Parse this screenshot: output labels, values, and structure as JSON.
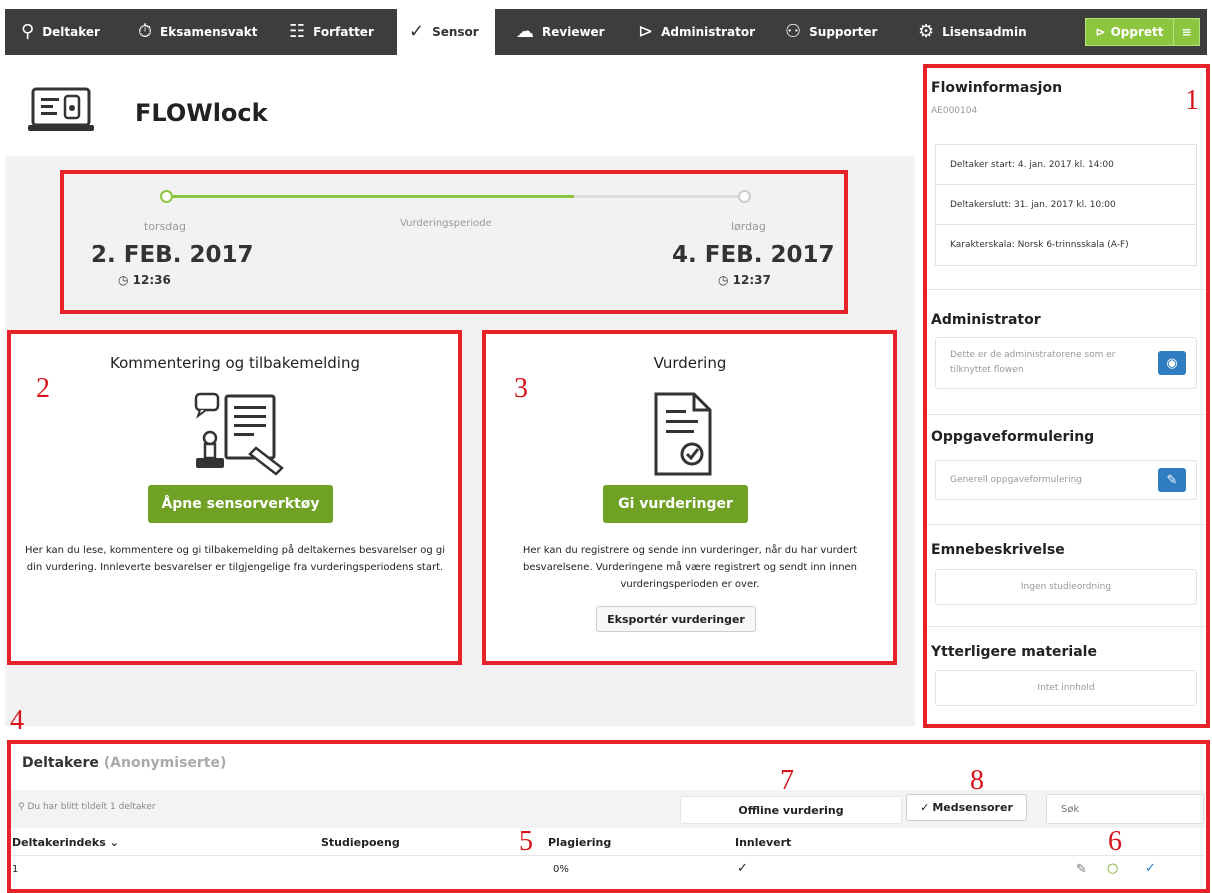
{
  "nav": {
    "tabs": [
      {
        "label": "Deltaker",
        "icon": "person-icon"
      },
      {
        "label": "Eksamensvakt",
        "icon": "stopwatch-icon"
      },
      {
        "label": "Forfatter",
        "icon": "list-icon"
      },
      {
        "label": "Sensor",
        "icon": "speech-check-icon"
      },
      {
        "label": "Reviewer",
        "icon": "speech-bubbles-icon"
      },
      {
        "label": "Administrator",
        "icon": "flow-icon"
      },
      {
        "label": "Supporter",
        "icon": "people-icon"
      },
      {
        "label": "Lisensadmin",
        "icon": "gear-person-icon"
      }
    ],
    "active_tab": "Sensor",
    "create_label": "Opprett"
  },
  "header": {
    "title": "FLOWlock"
  },
  "period": {
    "start_day": "torsdag",
    "start_date": "2. FEB. 2017",
    "start_time": "12:36",
    "label": "Vurderingsperiode",
    "end_day": "lørdag",
    "end_date": "4. FEB. 2017",
    "end_time": "12:37",
    "progress": 0.7
  },
  "comment_card": {
    "title": "Kommentering og tilbakemelding",
    "button": "Åpne sensorverktøy",
    "text": "Her kan du lese, kommentere og gi tilbakemelding på deltakernes besvarelser og gi din vurdering. Innleverte besvarelser er tilgjengelige fra vurderingsperiodens start."
  },
  "grading_card": {
    "title": "Vurdering",
    "button": "Gi vurderinger",
    "text": "Her kan du registrere og sende inn vurderinger, når du har vurdert besvarelsene. Vurderingene må være registrert og sendt inn innen vurderingsperioden er over.",
    "export_button": "Eksportér vurderinger"
  },
  "flowinfo": {
    "title": "Flowinformasjon",
    "code": "AE000104",
    "rows": [
      "Deltaker start: 4. jan. 2017 kl. 14:00",
      "Deltakerslutt: 31. jan. 2017 kl. 10:00",
      "Karakterskala: Norsk 6-trinnsskala (A-F)"
    ]
  },
  "administrator": {
    "title": "Administrator",
    "text": "Dette er de administratorene som er tilknyttet flowen"
  },
  "assignment": {
    "title": "Oppgaveformulering",
    "text": "Generell oppgaveformulering"
  },
  "subject": {
    "title": "Emnebeskrivelse",
    "text": "Ingen studieordning"
  },
  "extra": {
    "title": "Ytterligere materiale",
    "text": "Intet innhold"
  },
  "participants": {
    "title": "Deltakere",
    "title_note": "(Anonymiserte)",
    "assigned": "Du har blitt tildelt 1 deltaker",
    "offline_button": "Offline vurdering",
    "cosensor_button": "Medsensorer",
    "search_placeholder": "Søk",
    "columns": [
      "Deltakerindeks",
      "Studiepoeng",
      "Plagiering",
      "Innlevert"
    ],
    "rows": [
      {
        "index": "1",
        "credits": "",
        "plagiarism": "0%",
        "submitted": "✓"
      }
    ]
  },
  "markers": [
    "1",
    "2",
    "3",
    "4",
    "5",
    "6",
    "7",
    "8"
  ],
  "colors": {
    "accent": "#6fa224",
    "nav_bg": "#3d3d3d",
    "highlight": "#e8222a",
    "blue": "#2f7cc1"
  }
}
